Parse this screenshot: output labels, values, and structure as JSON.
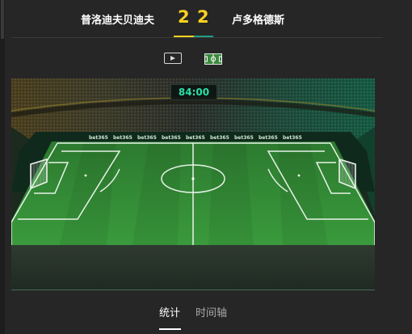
{
  "match": {
    "home_team": "普洛迪夫贝迪夫",
    "away_team": "卢多格德斯",
    "home_score": "2",
    "away_score": "2",
    "clock": "84:00"
  },
  "view_toggles": [
    {
      "icon": "video-play-icon",
      "selected": false
    },
    {
      "icon": "pitch-icon",
      "selected": true
    }
  ],
  "stage": {
    "sponsor": "bet365"
  },
  "tabs": [
    {
      "label": "统计",
      "active": true
    },
    {
      "label": "时间轴",
      "active": false
    }
  ],
  "colors": {
    "score": "#ffd21f",
    "home_accent": "#ffd21f",
    "away_accent": "#1f9f86",
    "clock_text": "#2ae0a8",
    "pitch_green": "#2f8a33"
  }
}
